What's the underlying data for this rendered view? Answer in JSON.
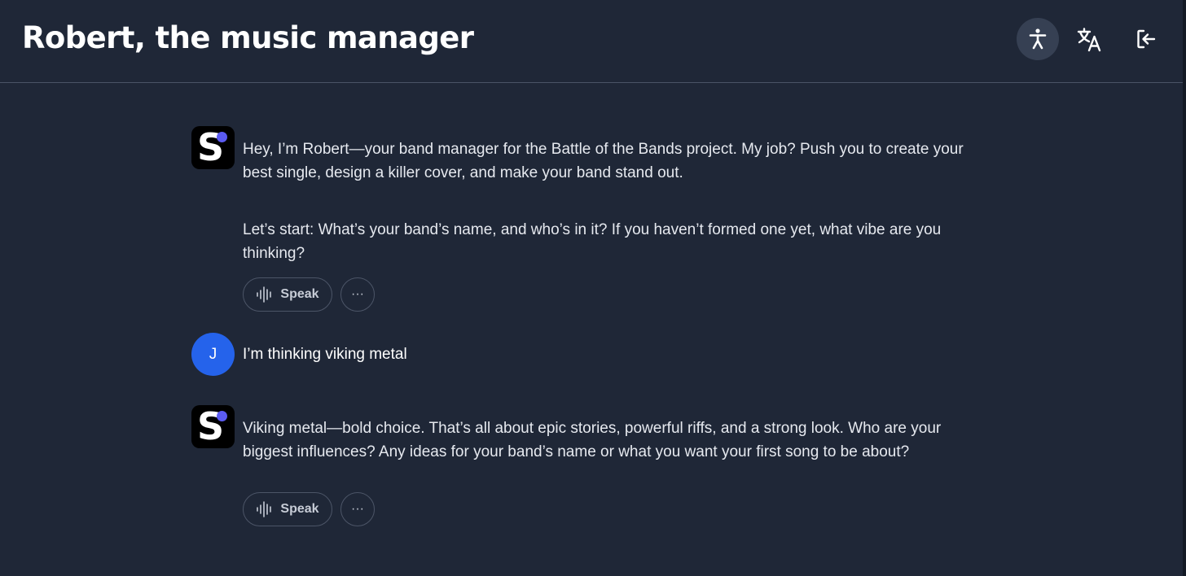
{
  "header": {
    "title": "Robert, the music manager",
    "icons": [
      "accessibility-icon",
      "translate-icon",
      "logout-icon"
    ]
  },
  "messages": [
    {
      "role": "assistant",
      "avatar_letter": "S",
      "paragraphs": [
        "Hey, I’m Robert—your band manager for the Battle of the Bands project. My job? Push you to create your best single, design a killer cover, and make your band stand out.",
        "Let’s start: What’s your band’s name, and who’s in it? If you haven’t formed one yet, what vibe are you thinking?"
      ],
      "speak_label": "Speak",
      "more_label": "···"
    },
    {
      "role": "user",
      "avatar_letter": "J",
      "text": "I’m thinking viking metal"
    },
    {
      "role": "assistant",
      "avatar_letter": "S",
      "paragraphs": [
        "Viking metal—bold choice. That’s all about epic stories, powerful riffs, and a strong look. Who are your biggest influences? Any ideas for your band’s name or what you want your first song to be about?"
      ],
      "speak_label": "Speak",
      "more_label": "···"
    }
  ],
  "colors": {
    "background": "#1f2737",
    "user_avatar": "#2563eb",
    "logo_dot": "#5b5bf2"
  }
}
